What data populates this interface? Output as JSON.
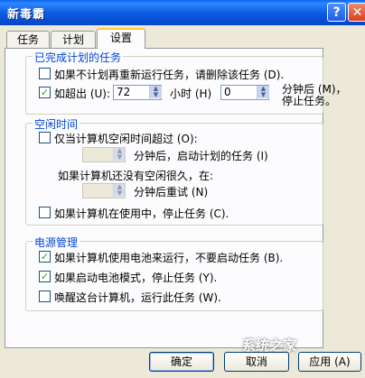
{
  "window": {
    "title": "新毒霸"
  },
  "titlebar": {
    "help_glyph": "?",
    "close_glyph": "✕"
  },
  "tabs": [
    {
      "label": "任务",
      "active": false
    },
    {
      "label": "计划",
      "active": false
    },
    {
      "label": "设置",
      "active": true
    }
  ],
  "completed_group": {
    "title": "已完成计划的任务",
    "delete_if_not_rescheduled": {
      "label": "如果不计划再重新运行任务，请删除该任务 (D).",
      "checked": false
    },
    "stop_if_exceeds": {
      "label": "如超出 (U):",
      "checked": true,
      "hours_value": "72",
      "hours_unit": "小时 (H)",
      "minutes_value": "0",
      "after_label_line1": "分钟后 (M)，",
      "after_label_line2": "停止任务。"
    }
  },
  "idle_group": {
    "title": "空闲时间",
    "only_if_idle": {
      "label": "仅当计算机空闲时间超过 (O):",
      "checked": false
    },
    "start_after_minutes": {
      "value": "",
      "label": "分钟后，启动计划的任务 (I)"
    },
    "not_idle_note": "如果计算机还没有空闲很久，在:",
    "retry_minutes": {
      "value": "",
      "label": "分钟后重试 (N)"
    },
    "stop_if_in_use": {
      "label": "如果计算机在使用中，停止任务 (C).",
      "checked": false
    }
  },
  "power_group": {
    "title": "电源管理",
    "dont_start_on_battery": {
      "label": "如果计算机使用电池来运行，不要启动任务 (B).",
      "checked": true
    },
    "stop_on_battery_mode": {
      "label": "如果启动电池模式，停止任务 (Y).",
      "checked": true
    },
    "wake_to_run": {
      "label": "唤醒这台计算机，运行此任务 (W).",
      "checked": false
    }
  },
  "buttons": {
    "ok": "确定",
    "cancel": "取消",
    "apply": "应用 (A)"
  },
  "watermark": "系统之家",
  "colors": {
    "titlebar": "#0a5ae0",
    "group_title": "#0046d5",
    "check": "#21a121"
  }
}
